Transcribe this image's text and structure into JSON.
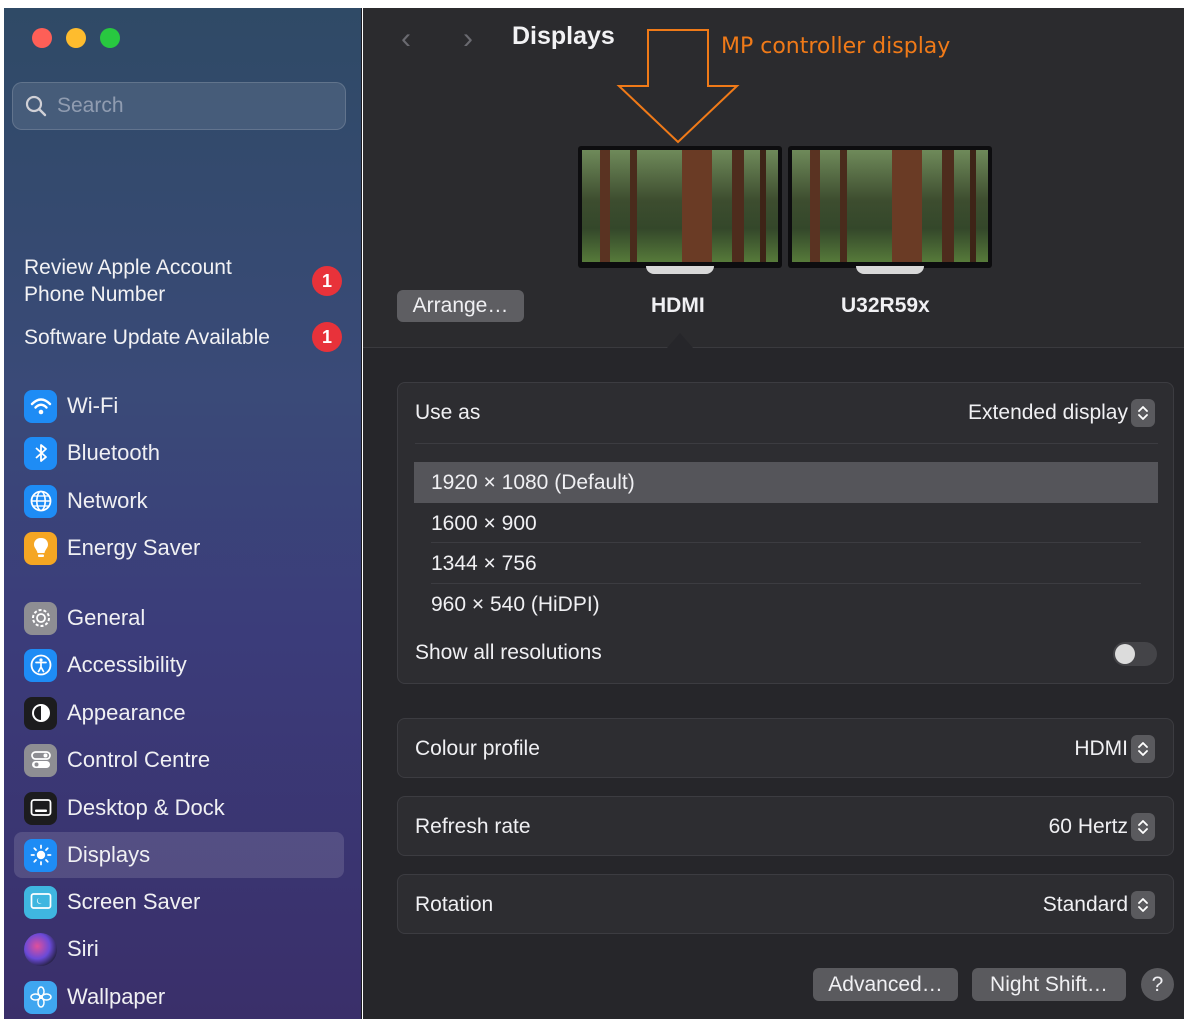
{
  "sidebar": {
    "search_placeholder": "Search",
    "notices": [
      {
        "text_line1": "Review Apple Account",
        "text_line2": "Phone Number",
        "badge": "1"
      },
      {
        "text": "Software Update Available",
        "badge": "1"
      }
    ],
    "items": [
      {
        "label": "Wi-Fi",
        "icon": "wifi-icon",
        "color": "#1e8cf5"
      },
      {
        "label": "Bluetooth",
        "icon": "bluetooth-icon",
        "color": "#1e8cf5"
      },
      {
        "label": "Network",
        "icon": "globe-icon",
        "color": "#1e8cf5"
      },
      {
        "label": "Energy Saver",
        "icon": "lightbulb-icon",
        "color": "#f5a623"
      },
      {
        "label": "General",
        "icon": "gear-icon",
        "color": "#8e8e93"
      },
      {
        "label": "Accessibility",
        "icon": "accessibility-icon",
        "color": "#1e8cf5"
      },
      {
        "label": "Appearance",
        "icon": "appearance-icon",
        "color": "#1c1c1e"
      },
      {
        "label": "Control Centre",
        "icon": "control-centre-icon",
        "color": "#8e8e93"
      },
      {
        "label": "Desktop & Dock",
        "icon": "dock-icon",
        "color": "#1c1c1e"
      },
      {
        "label": "Displays",
        "icon": "sun-icon",
        "color": "#1e8cf5"
      },
      {
        "label": "Screen Saver",
        "icon": "screen-saver-icon",
        "color": "#3fb6e0"
      },
      {
        "label": "Siri",
        "icon": "siri-icon",
        "color": "#2a2a40"
      },
      {
        "label": "Wallpaper",
        "icon": "flower-icon",
        "color": "#3fa6f0"
      }
    ]
  },
  "header": {
    "back_glyph": "‹",
    "forward_glyph": "›",
    "title": "Displays",
    "annotation": "MP controller display"
  },
  "displays": {
    "arrange_label": "Arrange…",
    "monitors": [
      "HDMI",
      "U32R59x"
    ]
  },
  "settings": {
    "use_as": {
      "label": "Use as",
      "value": "Extended display"
    },
    "resolutions": [
      "1920 × 1080 (Default)",
      "1600 × 900",
      "1344 × 756",
      "960 × 540 (HiDPI)"
    ],
    "show_all": {
      "label": "Show all resolutions",
      "enabled": false
    },
    "colour_profile": {
      "label": "Colour profile",
      "value": "HDMI"
    },
    "refresh_rate": {
      "label": "Refresh rate",
      "value": "60 Hertz"
    },
    "rotation": {
      "label": "Rotation",
      "value": "Standard"
    }
  },
  "footer": {
    "advanced_label": "Advanced…",
    "night_shift_label": "Night Shift…",
    "help_label": "?"
  },
  "colors": {
    "annotation": "#f07a18",
    "badge": "#e8323a",
    "accent": "#1e8cf5"
  }
}
